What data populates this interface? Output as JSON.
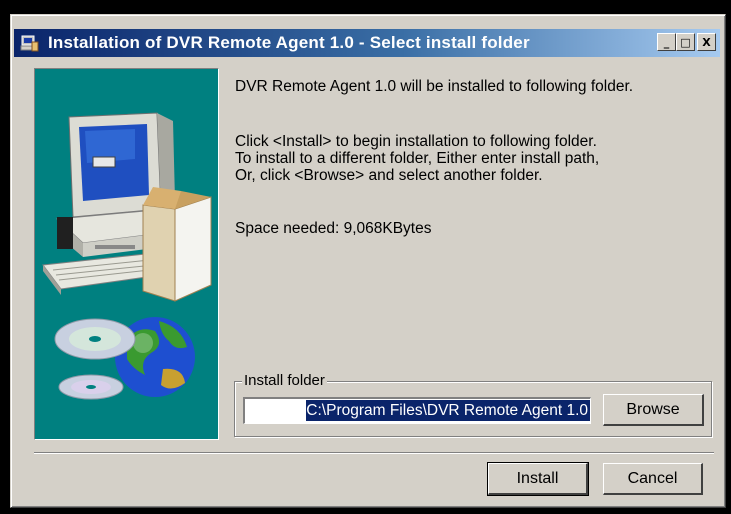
{
  "window": {
    "title": "Installation of DVR Remote Agent 1.0 - Select install folder",
    "controls": {
      "minimize": "_",
      "maximize": "□",
      "close": "X"
    }
  },
  "icons": {
    "app": "installer-icon",
    "illustration": "computer-and-globe-illustration"
  },
  "content": {
    "line1": "DVR Remote Agent 1.0 will be installed to following folder.",
    "instructions": [
      "Click <Install> to begin installation to following folder.",
      "To install to a different folder, Either enter install path,",
      "Or, click <Browse> and select another folder."
    ],
    "space_needed": "Space needed: 9,068KBytes"
  },
  "install_folder": {
    "label": "Install folder",
    "value": "C:\\Program Files\\DVR Remote Agent 1.0",
    "browse_label": "Browse"
  },
  "buttons": {
    "install": "Install",
    "cancel": "Cancel"
  },
  "colors": {
    "title_gradient_start": "#0a246a",
    "title_gradient_end": "#a6caf0",
    "panel_teal": "#008080",
    "dialog_face": "#d4d0c8"
  }
}
